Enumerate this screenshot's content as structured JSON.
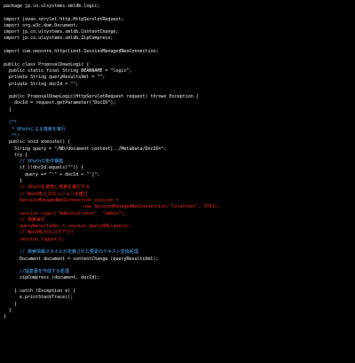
{
  "colors": {
    "background": "#000000",
    "plain": "#ffffff",
    "comment": "#5ab4ff",
    "highlight": "#ff2a2a"
  },
  "lines": [
    {
      "text": "package jp.co.ulsystems.xmldb.logic;",
      "kind": "plain",
      "indent": 0
    },
    {
      "text": "",
      "kind": "plain",
      "indent": 0
    },
    {
      "text": "import javax.servlet.http.HttpServletRequest;",
      "kind": "plain",
      "indent": 0
    },
    {
      "text": "import org.w3c.dom.Document;",
      "kind": "plain",
      "indent": 0
    },
    {
      "text": "import jp.co.ulsystems.xmldb.ContentChange;",
      "kind": "plain",
      "indent": 0
    },
    {
      "text": "import jp.co.ulsystems.xmldb.ZipCompress;",
      "kind": "plain",
      "indent": 0
    },
    {
      "text": "",
      "kind": "plain",
      "indent": 0
    },
    {
      "text": "import com.neocore.httpclient.SessionManagedNeoConnection;",
      "kind": "plain",
      "indent": 0
    },
    {
      "text": "",
      "kind": "plain",
      "indent": 0
    },
    {
      "text": "public class ProposalDownLogic {",
      "kind": "plain",
      "indent": 0
    },
    {
      "text": "public static final String BEANNAME = \"logic\";",
      "kind": "plain",
      "indent": 1
    },
    {
      "text": "private String queryResultsXml = \"\";",
      "kind": "plain",
      "indent": 1
    },
    {
      "text": "private String docId = \"\";",
      "kind": "plain",
      "indent": 1
    },
    {
      "text": "",
      "kind": "plain",
      "indent": 0
    },
    {
      "text": "public ProposalDownLogic(HttpServletRequest request) throws Exception {",
      "kind": "plain",
      "indent": 1
    },
    {
      "text": "docId = request.getParameter(\"DocID\");",
      "kind": "plain",
      "indent": 2
    },
    {
      "text": "}",
      "kind": "plain",
      "indent": 1
    },
    {
      "text": "",
      "kind": "plain",
      "indent": 0
    },
    {
      "text": "/**",
      "kind": "comment",
      "indent": 1
    },
    {
      "text": " * XPathによる検索を実行",
      "kind": "comment",
      "indent": 1
    },
    {
      "text": " **/",
      "kind": "comment",
      "indent": 1
    },
    {
      "text": "public void execute() {",
      "kind": "plain",
      "indent": 1
    },
    {
      "text": "String query = \"/ND/document-content[../MetaData/DocID=\";",
      "kind": "plain",
      "indent": 2
    },
    {
      "text": "try {",
      "kind": "plain",
      "indent": 2
    },
    {
      "text": "// XPathの条件構築",
      "kind": "comment",
      "indent": 3
    },
    {
      "text": "if (!docId.equals(\"\")) {",
      "kind": "plain",
      "indent": 3
    },
    {
      "text": "query += \"'\" + docId + \"']\";",
      "kind": "plain",
      "indent": 4
    },
    {
      "text": "}",
      "kind": "plain",
      "indent": 3
    },
    {
      "text": "// XPathを使用し検索を実行する",
      "kind": "highlight",
      "indent": 3
    },
    {
      "text": "// NeoXMLとのセッションを確立",
      "kind": "highlight",
      "indent": 3
    },
    {
      "text": "SessionManagedNeoConnection session =",
      "kind": "highlight",
      "indent": 3
    },
    {
      "text": "new SessionManagedNeoConnection(\"localhost\", 7701);",
      "kind": "highlight",
      "indent": 6
    },
    {
      "text": "session.login(\"Administrator\", \"admin\");",
      "kind": "highlight",
      "indent": 3
    },
    {
      "text": "// 検索実行",
      "kind": "highlight",
      "indent": 3
    },
    {
      "text": "queryResultsXml = session.queryXML(query);",
      "kind": "highlight",
      "indent": 3
    },
    {
      "text": "// NeoXMLからログアウト",
      "kind": "highlight",
      "indent": 3
    },
    {
      "text": "session.logout();",
      "kind": "highlight",
      "indent": 3
    },
    {
      "text": "",
      "kind": "plain",
      "indent": 0
    },
    {
      "text": "// 検索情報スタイルが定義された要素のテキスト変換処理",
      "kind": "comment",
      "indent": 3
    },
    {
      "text": "Document document = contentChange (queryResultsXml);",
      "kind": "plain",
      "indent": 3
    },
    {
      "text": "",
      "kind": "plain",
      "indent": 0
    },
    {
      "text": "//提案書を作成する処理",
      "kind": "comment",
      "indent": 3
    },
    {
      "text": "zipCompress (document, docId);",
      "kind": "plain",
      "indent": 3
    },
    {
      "text": "",
      "kind": "plain",
      "indent": 0
    },
    {
      "text": "} catch (Exception e) {",
      "kind": "plain",
      "indent": 2
    },
    {
      "text": "e.printStackTrace();",
      "kind": "plain",
      "indent": 3
    },
    {
      "text": "}",
      "kind": "plain",
      "indent": 2
    },
    {
      "text": "}",
      "kind": "plain",
      "indent": 1
    },
    {
      "text": "}",
      "kind": "plain",
      "indent": 0
    }
  ]
}
